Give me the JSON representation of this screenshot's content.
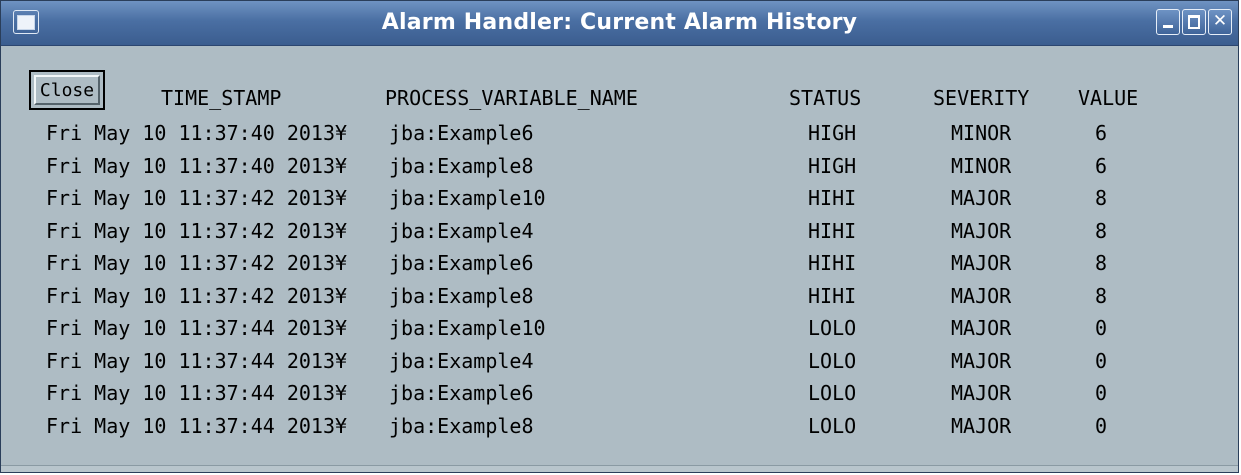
{
  "window": {
    "title": "Alarm Handler: Current Alarm History",
    "controls": {
      "minimize": "minimize",
      "maximize": "maximize",
      "close_glyph": "✕"
    }
  },
  "toolbar": {
    "close_label": "Close"
  },
  "columns": {
    "time_stamp": "TIME_STAMP",
    "process_variable_name": "PROCESS_VARIABLE_NAME",
    "status": "STATUS",
    "severity": "SEVERITY",
    "value": "VALUE"
  },
  "rows": [
    {
      "time": "Fri May 10 11:37:40 2013¥",
      "pv": "jba:Example6",
      "status": "HIGH",
      "severity": "MINOR",
      "value": "6"
    },
    {
      "time": "Fri May 10 11:37:40 2013¥",
      "pv": "jba:Example8",
      "status": "HIGH",
      "severity": "MINOR",
      "value": "6"
    },
    {
      "time": "Fri May 10 11:37:42 2013¥",
      "pv": "jba:Example10",
      "status": "HIHI",
      "severity": "MAJOR",
      "value": "8"
    },
    {
      "time": "Fri May 10 11:37:42 2013¥",
      "pv": "jba:Example4",
      "status": "HIHI",
      "severity": "MAJOR",
      "value": "8"
    },
    {
      "time": "Fri May 10 11:37:42 2013¥",
      "pv": "jba:Example6",
      "status": "HIHI",
      "severity": "MAJOR",
      "value": "8"
    },
    {
      "time": "Fri May 10 11:37:42 2013¥",
      "pv": "jba:Example8",
      "status": "HIHI",
      "severity": "MAJOR",
      "value": "8"
    },
    {
      "time": "Fri May 10 11:37:44 2013¥",
      "pv": "jba:Example10",
      "status": "LOLO",
      "severity": "MAJOR",
      "value": "0"
    },
    {
      "time": "Fri May 10 11:37:44 2013¥",
      "pv": "jba:Example4",
      "status": "LOLO",
      "severity": "MAJOR",
      "value": "0"
    },
    {
      "time": "Fri May 10 11:37:44 2013¥",
      "pv": "jba:Example6",
      "status": "LOLO",
      "severity": "MAJOR",
      "value": "0"
    },
    {
      "time": "Fri May 10 11:37:44 2013¥",
      "pv": "jba:Example8",
      "status": "LOLO",
      "severity": "MAJOR",
      "value": "0"
    }
  ]
}
